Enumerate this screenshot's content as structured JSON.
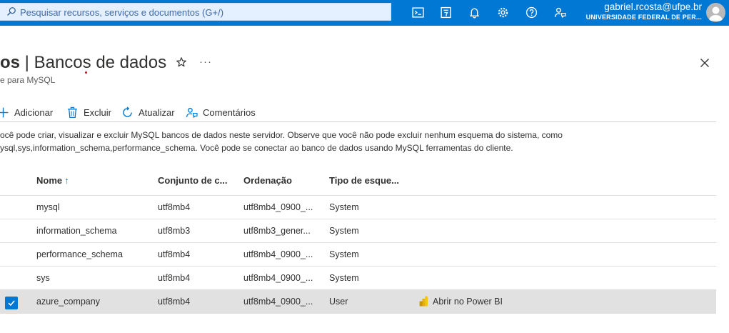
{
  "topbar": {
    "search_placeholder": "Pesquisar recursos, serviços e documentos (G+/)",
    "icons": [
      "cloud-shell-icon",
      "directory-filter-icon",
      "notifications-bell-icon",
      "settings-gear-icon",
      "help-question-icon",
      "feedback-icon"
    ],
    "user_email": "gabriel.rcosta@ufpe.br",
    "user_org": "UNIVERSIDADE FEDERAL DE PER..."
  },
  "header": {
    "title_prefix": "os",
    "title_separator": " | ",
    "title": "Bancos de dados",
    "subtitle": "e para MySQL",
    "more_label": "···"
  },
  "toolbar": {
    "add_label": "Adicionar",
    "delete_label": "Excluir",
    "refresh_label": "Atualizar",
    "feedback_label": "Comentários"
  },
  "description": {
    "line1": "ocê pode criar, visualizar e excluir MySQL bancos de dados neste servidor. Observe que você não pode excluir nenhum esquema do sistema, como",
    "line2": "ysql,sys,information_schema,performance_schema. Você pode se conectar ao banco de dados usando MySQL ferramentas do cliente."
  },
  "table": {
    "columns": [
      "Nome",
      "Conjunto de c...",
      "Ordenação",
      "Tipo de esque..."
    ],
    "sort_indicator": "↑",
    "rows": [
      {
        "name": "mysql",
        "charset": "utf8mb4",
        "collation": "utf8mb4_0900_...",
        "type": "System",
        "selected": false
      },
      {
        "name": "information_schema",
        "charset": "utf8mb3",
        "collation": "utf8mb3_gener...",
        "type": "System",
        "selected": false
      },
      {
        "name": "performance_schema",
        "charset": "utf8mb4",
        "collation": "utf8mb4_0900_...",
        "type": "System",
        "selected": false
      },
      {
        "name": "sys",
        "charset": "utf8mb4",
        "collation": "utf8mb4_0900_...",
        "type": "System",
        "selected": false
      },
      {
        "name": "azure_company",
        "charset": "utf8mb4",
        "collation": "utf8mb4_0900_...",
        "type": "User",
        "selected": true,
        "action": "Abrir no Power BI"
      }
    ]
  },
  "colors": {
    "topbar": "#0078d4",
    "search_bg": "#e4efff",
    "accent": "#0078d4",
    "selected_row": "#e1e1e1",
    "powerbi": "#f2c811"
  }
}
